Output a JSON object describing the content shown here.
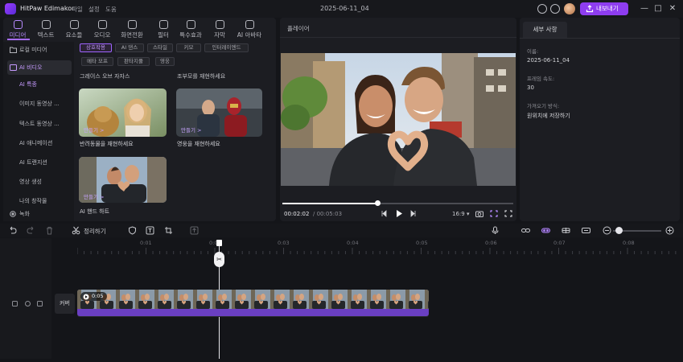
{
  "app": {
    "title": "HitPaw Edimakor",
    "menu": [
      "파일",
      "설정",
      "도움"
    ],
    "document_title": "2025-06-11_04",
    "export_label": "내보내기"
  },
  "topnav": [
    {
      "label": "미디어",
      "active": true
    },
    {
      "label": "텍스트"
    },
    {
      "label": "요소들"
    },
    {
      "label": "오디오"
    },
    {
      "label": "화면전환"
    },
    {
      "label": "필터"
    },
    {
      "label": "특수효과"
    },
    {
      "label": "자막"
    },
    {
      "label": "AI 아바타"
    }
  ],
  "sidebar": {
    "items": [
      {
        "label": "로컬 미디어",
        "state": "normal"
      },
      {
        "label": "AI 비디오",
        "state": "selected"
      },
      {
        "label": "AI 특종",
        "state": "subselected"
      },
      {
        "label": "이미지 동영상 ...",
        "state": "sub"
      },
      {
        "label": "텍스트 동영상 ...",
        "state": "sub"
      },
      {
        "label": "AI 애니메이션",
        "state": "sub"
      },
      {
        "label": "AI 트랜지션",
        "state": "sub"
      },
      {
        "label": "영상 생성",
        "state": "sub"
      },
      {
        "label": "나의 창작물",
        "state": "sub"
      },
      {
        "label": "녹화",
        "state": "normal"
      }
    ]
  },
  "chips": [
    {
      "label": "상호작용",
      "active": true
    },
    {
      "label": "AI 댄스"
    },
    {
      "label": "스타일"
    },
    {
      "label": "키모"
    },
    {
      "label": "인터레이엔드"
    },
    {
      "label": "메타 모프"
    },
    {
      "label": "판타지풀"
    },
    {
      "label": "영웅"
    }
  ],
  "sections": {
    "col1_title": "그레이스 오브 자자스",
    "col2_title": "조부모를 재현하세요"
  },
  "cards": [
    {
      "action": "만들기 >",
      "caption": "반려동물을 재현하세요"
    },
    {
      "action": "만들기 >",
      "caption": "영웅을 재현하세요"
    },
    {
      "action": "만들기 >",
      "caption": "AI 핸드 하트"
    }
  ],
  "player": {
    "title": "플레이어",
    "current_time": "00:02:02",
    "total_time": "/ 00:05:03",
    "progress": 0.41,
    "ratio": "16:9"
  },
  "properties": {
    "tab": "세부 사항",
    "name_label": "이름:",
    "name_value": "2025-06-11_04",
    "fps_label": "프레임 속도:",
    "fps_value": "30",
    "import_label": "가져오기 방식:",
    "import_value": "원위치에 저장하기"
  },
  "toolbar": {
    "tidy_label": "정리하기"
  },
  "timeline": {
    "ruler": [
      "0:01",
      "0:02",
      "0:03",
      "0:04",
      "0:05",
      "0:06",
      "0:07",
      "0:08"
    ],
    "cover_label": "커버",
    "clip_duration": "0:05"
  },
  "colors": {
    "accent": "#8e3df0",
    "accent_text": "#c69bff",
    "audio_track": "#6a3fc2",
    "panel": "#1c1d22",
    "background": "#141519"
  }
}
